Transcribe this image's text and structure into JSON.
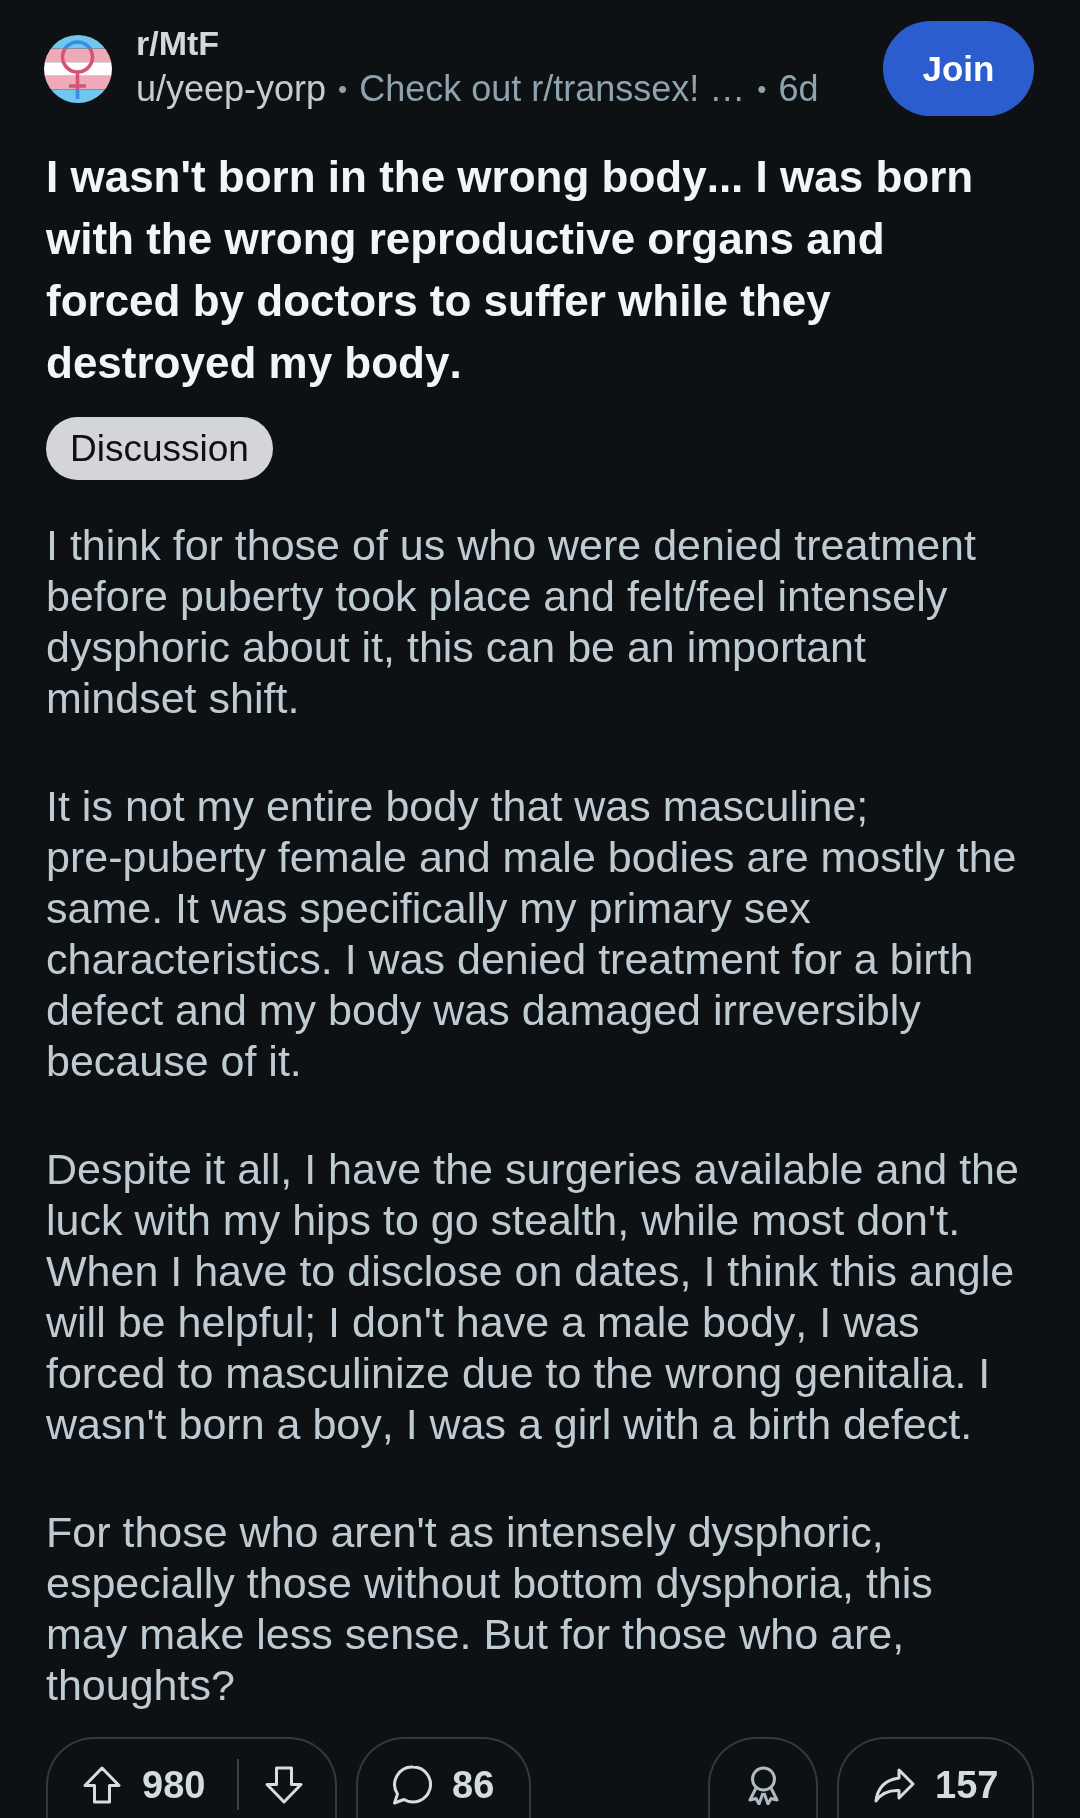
{
  "header": {
    "community": "r/MtF",
    "meta": [
      {
        "kind": "author",
        "text": "u/yeep-yorp"
      },
      {
        "kind": "separator",
        "text": "•"
      },
      {
        "kind": "flair",
        "text": "Check out r/transsex! …"
      },
      {
        "kind": "separator",
        "text": "•"
      },
      {
        "kind": "time",
        "text": "6d"
      }
    ],
    "join_button": "Join"
  },
  "post": {
    "title": "I wasn't born in the wrong body... I was born with the wrong reproductive organs and forced by doctors to suffer while they destroyed my body.",
    "flair": "Discussion",
    "paragraphs": [
      "I think for those of us who were denied treatment before puberty took place and felt/feel intensely dysphoric about it, this can be an important mindset shift.",
      "It is not my entire body that was masculine; pre-puberty female and male bodies are mostly the same. It was specifically my primary sex characteristics. I was denied treatment for a birth defect and my body was damaged irreversibly because of it.",
      "Despite it all, I have the surgeries available and the luck with my hips to go stealth, while most don't. When I have to disclose on dates, I think this angle will be helpful; I don't have a male body, I was forced to masculinize due to the wrong genitalia. I wasn't born a boy, I was a girl with a birth defect.",
      "For those who aren't as intensely dysphoric, especially those without bottom dysphoria, this may make less sense. But for those who are, thoughts?"
    ]
  },
  "actions": [
    {
      "kind": "vote",
      "count": "980"
    },
    {
      "kind": "comment",
      "count": "86"
    },
    {
      "kind": "award"
    },
    {
      "kind": "share",
      "count": "157"
    }
  ]
}
